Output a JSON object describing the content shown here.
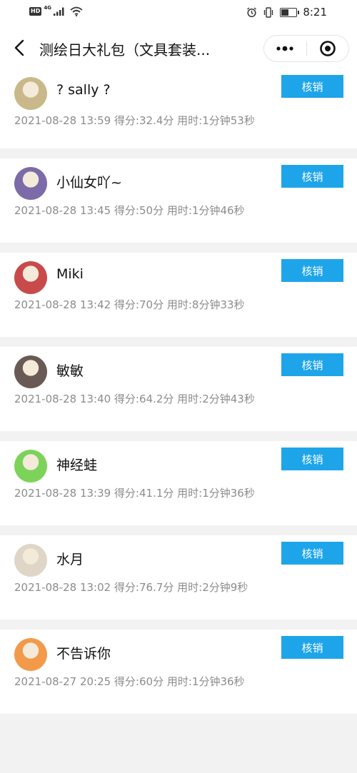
{
  "status_bar": {
    "hd": "HD",
    "network": "4G",
    "time": "8:21",
    "battery_level": 0.5
  },
  "nav": {
    "title": "测绘日大礼包（文具套装...",
    "back_icon": "chevron-left-icon",
    "more_icon": "more-dots-icon",
    "close_icon": "target-circle-icon"
  },
  "records": [
    {
      "name": "? sally ?",
      "meta": "2021-08-28 13:59 得分:32.4分 用时:1分钟53秒",
      "action": "核销",
      "avatar_color": "#c9b98a"
    },
    {
      "name": "小仙女吖~",
      "meta": "2021-08-28 13:45 得分:50分 用时:1分钟46秒",
      "action": "核销",
      "avatar_color": "#7c6ba8"
    },
    {
      "name": "Miki",
      "meta": "2021-08-28 13:42 得分:70分 用时:8分钟33秒",
      "action": "核销",
      "avatar_color": "#c84a4a"
    },
    {
      "name": "敏敏",
      "meta": "2021-08-28 13:40 得分:64.2分 用时:2分钟43秒",
      "action": "核销",
      "avatar_color": "#6a5a55"
    },
    {
      "name": "神经蛙",
      "meta": "2021-08-28 13:39 得分:41.1分 用时:1分钟36秒",
      "action": "核销",
      "avatar_color": "#7dd35a"
    },
    {
      "name": "水月",
      "meta": "2021-08-28 13:02 得分:76.7分 用时:2分钟9秒",
      "action": "核销",
      "avatar_color": "#e0d6c8"
    },
    {
      "name": "不告诉你",
      "meta": "2021-08-27 20:25 得分:60分 用时:1分钟36秒",
      "action": "核销",
      "avatar_color": "#f29a4a"
    }
  ],
  "colors": {
    "accent": "#1ea5e9",
    "meta_text": "#8c8c8c",
    "background": "#f2f2f2"
  }
}
